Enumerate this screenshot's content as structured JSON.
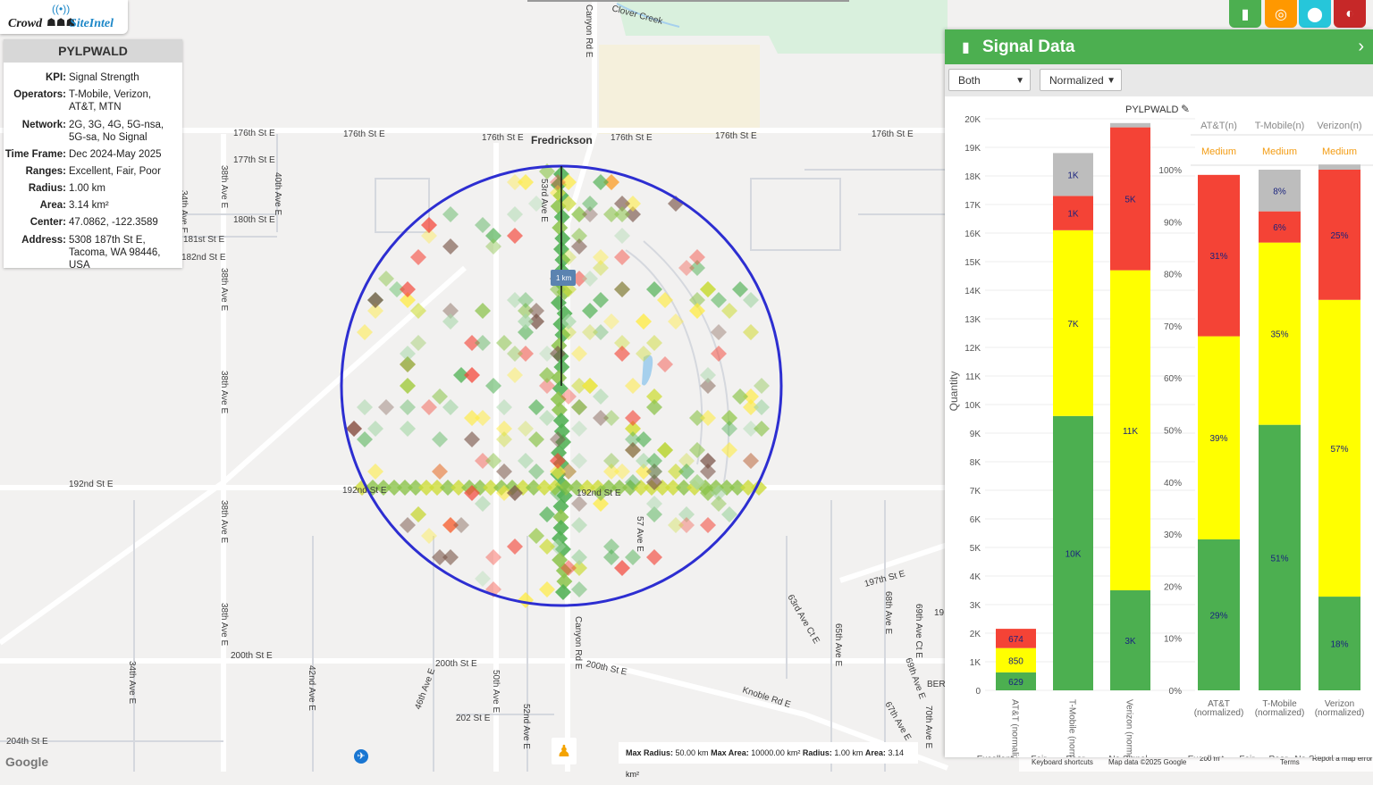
{
  "logo": {
    "part1": "Crowd",
    "part2": "SiteIntel"
  },
  "info": {
    "title": "PYLPWALD",
    "rows": [
      {
        "k": "KPI:",
        "v": "Signal Strength"
      },
      {
        "k": "Operators:",
        "v": "T-Mobile, Verizon, AT&T, MTN"
      },
      {
        "k": "Network:",
        "v": "2G, 3G, 4G, 5G-nsa, 5G-sa, No Signal"
      },
      {
        "k": "Time Frame:",
        "v": "Dec 2024-May 2025"
      },
      {
        "k": "Ranges:",
        "v": "Excellent, Fair, Poor"
      },
      {
        "k": "Radius:",
        "v": "1.00 km"
      },
      {
        "k": "Area:",
        "v": "3.14 km²"
      },
      {
        "k": "Center:",
        "v": "47.0862, -122.3589"
      },
      {
        "k": "Address:",
        "v": "5308 187th St E, Tacoma, WA 98446, USA"
      }
    ]
  },
  "toolbar": {
    "buttons": [
      {
        "name": "chart-icon",
        "color": "#4caf50",
        "glyph": "▮"
      },
      {
        "name": "target-icon",
        "color": "#ff9800",
        "glyph": "◎"
      },
      {
        "name": "location-pin-icon",
        "color": "#26c6da",
        "glyph": "⬤"
      },
      {
        "name": "globe-icon",
        "color": "#c62828",
        "glyph": "◐"
      }
    ]
  },
  "map": {
    "labels": [
      {
        "text": "Fredrickson",
        "bold": true
      },
      {
        "text": "176th St E"
      },
      {
        "text": "176th St E"
      },
      {
        "text": "176th St E"
      },
      {
        "text": "176th St E"
      },
      {
        "text": "176th St E"
      },
      {
        "text": "176th St E"
      },
      {
        "text": "177th St E"
      },
      {
        "text": "180th St E"
      },
      {
        "text": "181st St E"
      },
      {
        "text": "182nd St E"
      },
      {
        "text": "192nd St E"
      },
      {
        "text": "192nd St E"
      },
      {
        "text": "192nd St E"
      },
      {
        "text": "200th St E"
      },
      {
        "text": "200th St E"
      },
      {
        "text": "200th St E"
      },
      {
        "text": "202 St E"
      },
      {
        "text": "204th St E"
      },
      {
        "text": "197th St E"
      },
      {
        "text": "Knoble Rd E"
      },
      {
        "text": "Clover Creek"
      },
      {
        "text": "Canyon Rd E"
      },
      {
        "text": "Canyon Rd E"
      },
      {
        "text": "38th Ave E"
      },
      {
        "text": "38th Ave E"
      },
      {
        "text": "38th Ave E"
      },
      {
        "text": "38th Ave E"
      },
      {
        "text": "38th Ave E"
      },
      {
        "text": "40th Ave E"
      },
      {
        "text": "34th Ave E"
      },
      {
        "text": "34th Ave E"
      },
      {
        "text": "42nd Ave E"
      },
      {
        "text": "46th Ave E"
      },
      {
        "text": "50th Ave E"
      },
      {
        "text": "52nd Ave E"
      },
      {
        "text": "53rd Ave E"
      },
      {
        "text": "57 Ave E"
      },
      {
        "text": "63rd Ave Ct E"
      },
      {
        "text": "65th Ave E"
      },
      {
        "text": "68th Ave E"
      },
      {
        "text": "69th Ave Ct E"
      },
      {
        "text": "69th Ave E"
      },
      {
        "text": "67th Ave E"
      },
      {
        "text": "70th Ave E"
      },
      {
        "text": "1 km"
      },
      {
        "text": "BER"
      },
      {
        "text": "19"
      }
    ],
    "scale_info": {
      "max_radius_k": "Max Radius:",
      "max_radius_v": "50.00 km",
      "max_area_k": "Max Area:",
      "max_area_v": "10000.00 km²",
      "radius_k": "Radius:",
      "radius_v": "1.00 km",
      "area_k": "Area:",
      "area_v": "3.14 km²"
    },
    "google": "Google",
    "attribution": [
      "Keyboard shortcuts",
      "Map data ©2025 Google",
      "200 m",
      "Terms",
      "Report a map error"
    ]
  },
  "panel": {
    "title": "Signal Data",
    "operator_select": "Both",
    "mode_select": "Normalized",
    "location_label": "PYLPWALD"
  },
  "colors": {
    "excellent": "#4caf50",
    "fair": "#ffff00",
    "poor": "#f44336",
    "nosignal": "#bdbdbd",
    "accent": "#4caf50"
  },
  "chart_data": [
    {
      "type": "bar",
      "stacked": true,
      "ylabel": "Quantity",
      "ylim": [
        0,
        20000
      ],
      "yticks": [
        "0",
        "1K",
        "2K",
        "3K",
        "4K",
        "5K",
        "6K",
        "7K",
        "8K",
        "9K",
        "10K",
        "11K",
        "12K",
        "13K",
        "14K",
        "15K",
        "16K",
        "17K",
        "18K",
        "19K",
        "20K"
      ],
      "categories": [
        "AT&T (normalized)",
        "T-Mobile (normalized)",
        "Verizon (normalized)"
      ],
      "series": [
        {
          "name": "Excellent",
          "values": [
            629,
            9600,
            3500
          ],
          "labels": [
            "629",
            "10K",
            "3K"
          ]
        },
        {
          "name": "Fair",
          "values": [
            850,
            6500,
            11200
          ],
          "labels": [
            "850",
            "7K",
            "11K"
          ]
        },
        {
          "name": "Poor",
          "values": [
            674,
            1200,
            5000
          ],
          "labels": [
            "674",
            "1K",
            "5K"
          ]
        },
        {
          "name": "No Signal",
          "values": [
            0,
            1500,
            150
          ],
          "labels": [
            "",
            "1K",
            ""
          ]
        }
      ],
      "legend": [
        "Excellent",
        "Fair",
        "Poor",
        "No Signal"
      ]
    },
    {
      "type": "bar",
      "stacked": true,
      "ylim": [
        0,
        100
      ],
      "yticks": [
        "0%",
        "10%",
        "20%",
        "30%",
        "40%",
        "50%",
        "60%",
        "70%",
        "80%",
        "90%",
        "100%"
      ],
      "column_headers": [
        "AT&T(n)",
        "T-Mobile(n)",
        "Verizon(n)"
      ],
      "ratings": [
        "Medium",
        "Medium",
        "Medium"
      ],
      "categories": [
        "AT&T (normalized)",
        "T-Mobile (normalized)",
        "Verizon (normalized)"
      ],
      "series": [
        {
          "name": "Excellent",
          "values": [
            29,
            51,
            18
          ],
          "labels": [
            "29%",
            "51%",
            "18%"
          ]
        },
        {
          "name": "Fair",
          "values": [
            39,
            35,
            57
          ],
          "labels": [
            "39%",
            "35%",
            "57%"
          ]
        },
        {
          "name": "Poor",
          "values": [
            31,
            6,
            25
          ],
          "labels": [
            "31%",
            "6%",
            "25%"
          ]
        },
        {
          "name": "No Signal",
          "values": [
            0,
            8,
            1
          ],
          "labels": [
            "",
            "8%",
            ""
          ]
        }
      ],
      "legend": [
        "Excellent",
        "Fair",
        "Poor",
        "No Signal"
      ]
    }
  ]
}
